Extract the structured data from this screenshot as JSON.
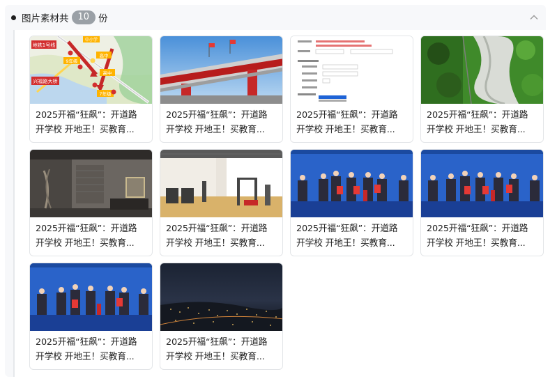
{
  "header": {
    "prefix": "图片素材共",
    "count": "10",
    "suffix": "份"
  },
  "map_labels": {
    "line": "地铁1号线",
    "bridge": "兴福路大桥",
    "school1": "中小学",
    "school2": "高中",
    "school3": "高中",
    "school4": "7年级",
    "school5": "9年级"
  },
  "cards": [
    {
      "thumb": "map-thumbnail",
      "line1": "2025开福“狂飙”：开道路",
      "line2": "开学校 开地王！买教育..."
    },
    {
      "thumb": "gate-thumbnail",
      "line1": "2025开福“狂飙”：开道路",
      "line2": "开学校 开地王！买教育..."
    },
    {
      "thumb": "form-thumbnail",
      "line1": "2025开福“狂飙”：开道路",
      "line2": "开学校 开地王！买教育..."
    },
    {
      "thumb": "garden-thumbnail",
      "line1": "2025开福“狂飙”：开道路",
      "line2": "开学校 开地王！买教育..."
    },
    {
      "thumb": "lobby-thumbnail",
      "line1": "2025开福“狂飙”：开道路",
      "line2": "开学校 开地王！买教育..."
    },
    {
      "thumb": "gym-thumbnail",
      "line1": "2025开福“狂飙”：开道路",
      "line2": "开学校 开地王！买教育..."
    },
    {
      "thumb": "signing-thumbnail",
      "line1": "2025开福“狂飙”：开道路",
      "line2": "开学校 开地王！买教育..."
    },
    {
      "thumb": "signing-thumbnail",
      "line1": "2025开福“狂飙”：开道路",
      "line2": "开学校 开地王！买教育..."
    },
    {
      "thumb": "signing-thumbnail",
      "line1": "2025开福“狂飙”：开道路",
      "line2": "开学校 开地王！买教育..."
    },
    {
      "thumb": "night-city-thumbnail",
      "line1": "2025开福“狂飙”：开道路",
      "line2": "开学校 开地王！买教育..."
    }
  ],
  "icons": {
    "collapse": "chevron-up-icon",
    "bullet": "bullet-dot-icon"
  },
  "colors": {
    "badge": "#9aa0a6",
    "panel_bg": "#f7f8fa",
    "card_border": "#e3e5e8",
    "stage_blue": "#1f4fb0",
    "map_red": "#d32f2f",
    "map_green": "#9ed19a"
  }
}
